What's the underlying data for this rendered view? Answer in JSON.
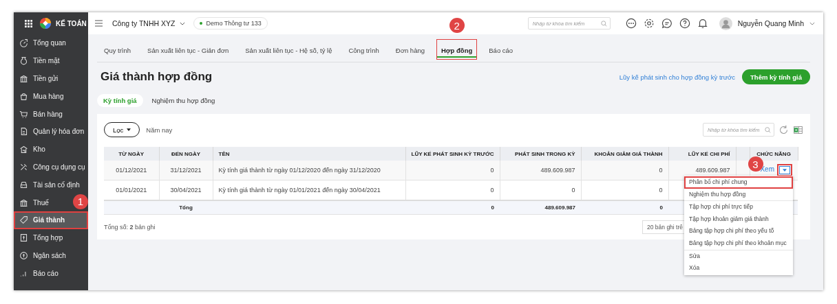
{
  "app": {
    "brand": "KẾ TOÁN"
  },
  "sidebar": {
    "items": [
      {
        "label": "Tổng quan",
        "selected": false,
        "highlighted": false
      },
      {
        "label": "Tiền mặt",
        "selected": false,
        "highlighted": false
      },
      {
        "label": "Tiền gửi",
        "selected": false,
        "highlighted": false
      },
      {
        "label": "Mua hàng",
        "selected": false,
        "highlighted": false
      },
      {
        "label": "Bán hàng",
        "selected": false,
        "highlighted": false
      },
      {
        "label": "Quản lý hóa đơn",
        "selected": false,
        "highlighted": false
      },
      {
        "label": "Kho",
        "selected": false,
        "highlighted": false
      },
      {
        "label": "Công cụ dụng cụ",
        "selected": false,
        "highlighted": false
      },
      {
        "label": "Tài sản cố định",
        "selected": false,
        "highlighted": false
      },
      {
        "label": "Thuế",
        "selected": false,
        "highlighted": false
      },
      {
        "label": "Giá thành",
        "selected": true,
        "highlighted": true,
        "callout": "1"
      },
      {
        "label": "Tổng hợp",
        "selected": false,
        "highlighted": false
      },
      {
        "label": "Ngân sách",
        "selected": false,
        "highlighted": false
      },
      {
        "label": "Báo cáo",
        "selected": false,
        "highlighted": false
      }
    ]
  },
  "topbar": {
    "company": "Công ty TNHH XYZ",
    "environment": "Demo Thông tư 133",
    "search": {
      "placeholder": "Nhập từ khóa tìm kiếm"
    },
    "user": "Nguyễn Quang Minh"
  },
  "tabs": [
    {
      "label": "Quy trình",
      "selected": false,
      "highlighted": false
    },
    {
      "label": "Sản xuất liên tục - Giản đơn",
      "selected": false,
      "highlighted": false
    },
    {
      "label": "Sản xuất liên tục - Hệ số, tỷ lệ",
      "selected": false,
      "highlighted": false
    },
    {
      "label": "Công trình",
      "selected": false,
      "highlighted": false
    },
    {
      "label": "Đơn hàng",
      "selected": false,
      "highlighted": false
    },
    {
      "label": "Hợp đồng",
      "selected": true,
      "highlighted": true,
      "callout": "2"
    },
    {
      "label": "Báo cáo",
      "selected": false,
      "highlighted": false
    }
  ],
  "page": {
    "title": "Giá thành hợp đồng",
    "link": "Lũy kế phát sinh cho hợp đồng kỳ trước",
    "primary_button": "Thêm kỳ tính giá"
  },
  "subtabs": [
    {
      "label": "Kỳ tính giá",
      "selected": true
    },
    {
      "label": "Nghiệm thu hợp đồng",
      "selected": false
    }
  ],
  "filter": {
    "button": "Lọc",
    "period": "Năm nay",
    "search": {
      "placeholder": "Nhập từ khóa tìm kiếm"
    }
  },
  "table": {
    "columns": [
      "TỪ NGÀY",
      "ĐẾN NGÀY",
      "TÊN",
      "LŨY KẾ PHÁT SINH KỲ TRƯỚC",
      "PHÁT SINH TRONG KỲ",
      "KHOẢN GIẢM GIÁ THÀNH",
      "LŨY KẾ CHI PHÍ",
      "CHỨC NĂNG"
    ],
    "rows": [
      {
        "cells": [
          "01/12/2021",
          "31/12/2021",
          "Kỳ tính giá thành từ ngày 01/12/2020 đến ngày 31/12/2020",
          "0",
          "489.609.987",
          "0",
          "489.609.987"
        ],
        "action": "Xem",
        "toggle_highlighted": true,
        "callout": "3"
      },
      {
        "cells": [
          "01/01/2021",
          "30/04/2021",
          "Kỳ tính giá thành từ ngày 01/01/2021 đến ngày 30/04/2021",
          "0",
          "0",
          "0",
          null
        ]
      }
    ],
    "total": {
      "label": "Tổng",
      "cells": [
        "0",
        "489.609.987",
        "0",
        null
      ]
    }
  },
  "footer": {
    "count": "Tổng số: **2** bản ghi",
    "page_size": "20 bản ghi trê"
  },
  "action_menu": {
    "groups": [
      [
        {
          "label": "Phân bổ chi phí chung",
          "highlighted": true
        },
        {
          "label": "Nghiệm thu hợp đồng",
          "highlighted": false
        }
      ],
      [
        {
          "label": "Tập hợp chi phí trực tiếp",
          "highlighted": false
        },
        {
          "label": "Tập hợp khoản giảm giá thành",
          "highlighted": false
        },
        {
          "label": "Bảng tập hợp chi phí theo yếu tố",
          "highlighted": false
        },
        {
          "label": "Bảng tập hợp chi phí theo khoản mục",
          "highlighted": false
        }
      ],
      [
        {
          "label": "Sửa",
          "highlighted": false
        },
        {
          "label": "Xóa",
          "highlighted": false
        }
      ]
    ]
  }
}
